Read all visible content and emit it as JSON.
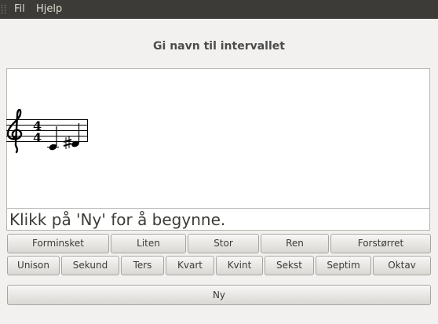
{
  "menu": {
    "file": "Fil",
    "help": "Hjelp"
  },
  "exercise_title": "Gi navn til intervallet",
  "status_text": "Klikk på 'Ny' for å begynne.",
  "quality_buttons": [
    "Forminsket",
    "Liten",
    "Stor",
    "Ren",
    "Forstørret"
  ],
  "interval_buttons": [
    "Unison",
    "Sekund",
    "Ters",
    "Kvart",
    "Kvint",
    "Sekst",
    "Septim",
    "Oktav"
  ],
  "new_button": "Ny",
  "notation": {
    "clef": "treble",
    "time_signature": {
      "top": "4",
      "bottom": "4"
    },
    "notes": [
      {
        "pitch": "C4",
        "accidental": "none"
      },
      {
        "pitch": "D#4",
        "accidental": "sharp"
      }
    ]
  }
}
